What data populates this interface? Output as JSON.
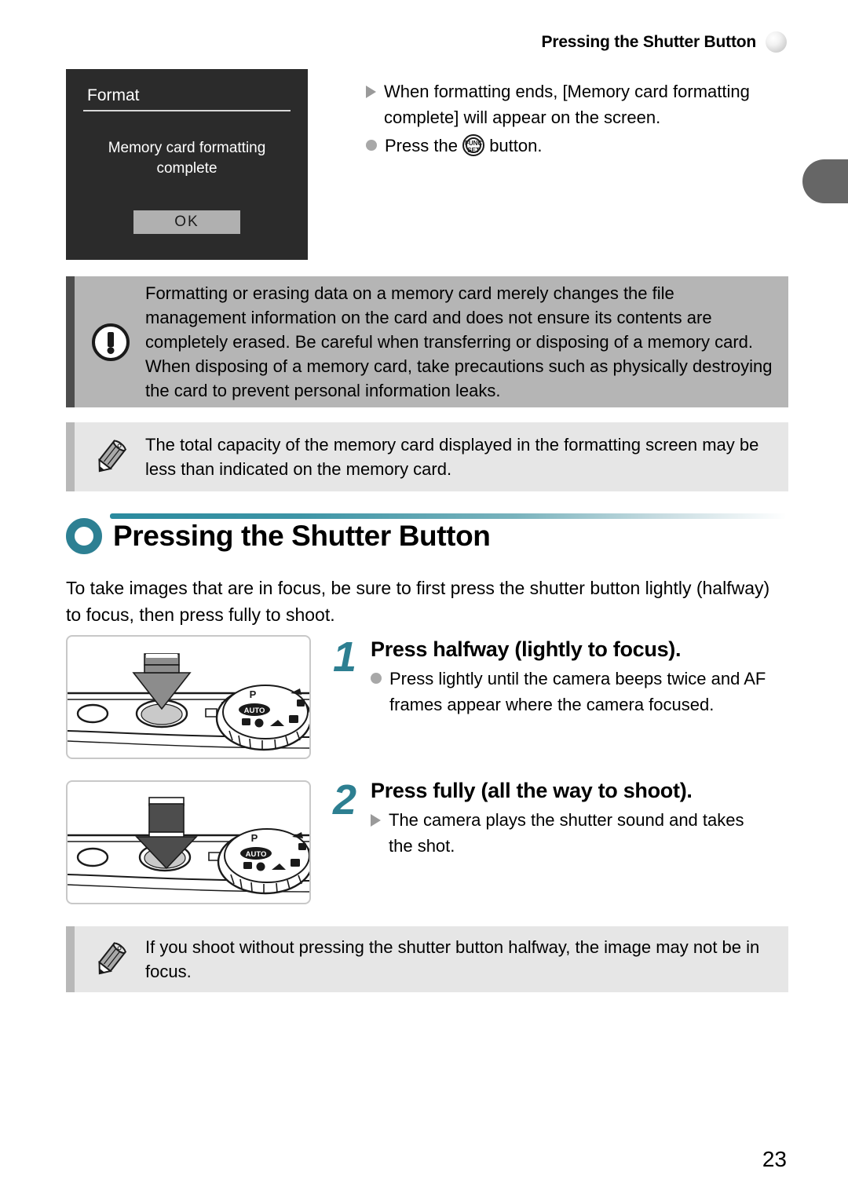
{
  "header": {
    "title": "Pressing the Shutter Button",
    "dot_icon": "sphere-icon"
  },
  "edge_tab": {
    "color": "#666666"
  },
  "lcd_screen": {
    "title": "Format",
    "message_line1": "Memory card formatting",
    "message_line2": "complete",
    "ok_label": "OK"
  },
  "format_steps": {
    "result_bullet": "triangle",
    "result_text": "When formatting ends, [Memory card formatting complete] will appear on the screen.",
    "action_bullet": "dot",
    "action_text_before": "Press the",
    "action_icon": "func-set-icon",
    "action_icon_top": "FUNC",
    "action_icon_bottom": "SET",
    "action_text_after": "button."
  },
  "warning_callout": {
    "icon": "exclamation-icon",
    "text": "Formatting or erasing data on a memory card merely changes the file management information on the card and does not ensure its contents are completely erased. Be careful when transferring or disposing of a memory card. When disposing of a memory card, take precautions such as physically destroying the card to prevent personal information leaks.",
    "bar_color": "#4d4d4d",
    "bg_color": "#b5b5b5"
  },
  "note_callout_top": {
    "icon": "pencil-icon",
    "text": "The total capacity of the memory card displayed in the formatting screen may be less than indicated on the memory card.",
    "bar_color": "#b8b8b8",
    "bg_color": "#e6e6e6"
  },
  "section": {
    "icon": "ring-icon",
    "accent_color": "#2d8093",
    "title": "Pressing the Shutter Button",
    "intro": "To take images that are in focus, be sure to first press the shutter button lightly (halfway) to focus, then press fully to shoot."
  },
  "steps": [
    {
      "number": "1",
      "title": "Press halfway (lightly to focus).",
      "bullet": "dot",
      "body": "Press lightly until the camera beeps twice and AF frames appear where the camera focused.",
      "figure": "camera-top-halfway-press",
      "dial_auto_label": "AUTO",
      "dial_p_label": "P"
    },
    {
      "number": "2",
      "title": "Press fully (all the way to shoot).",
      "bullet": "triangle",
      "body": "The camera plays the shutter sound and takes the shot.",
      "figure": "camera-top-full-press",
      "dial_auto_label": "AUTO",
      "dial_p_label": "P"
    }
  ],
  "note_callout_bottom": {
    "icon": "pencil-icon",
    "text": "If you shoot without pressing the shutter button halfway, the image may not be in focus.",
    "bar_color": "#b8b8b8",
    "bg_color": "#e6e6e6"
  },
  "page_number": "23"
}
